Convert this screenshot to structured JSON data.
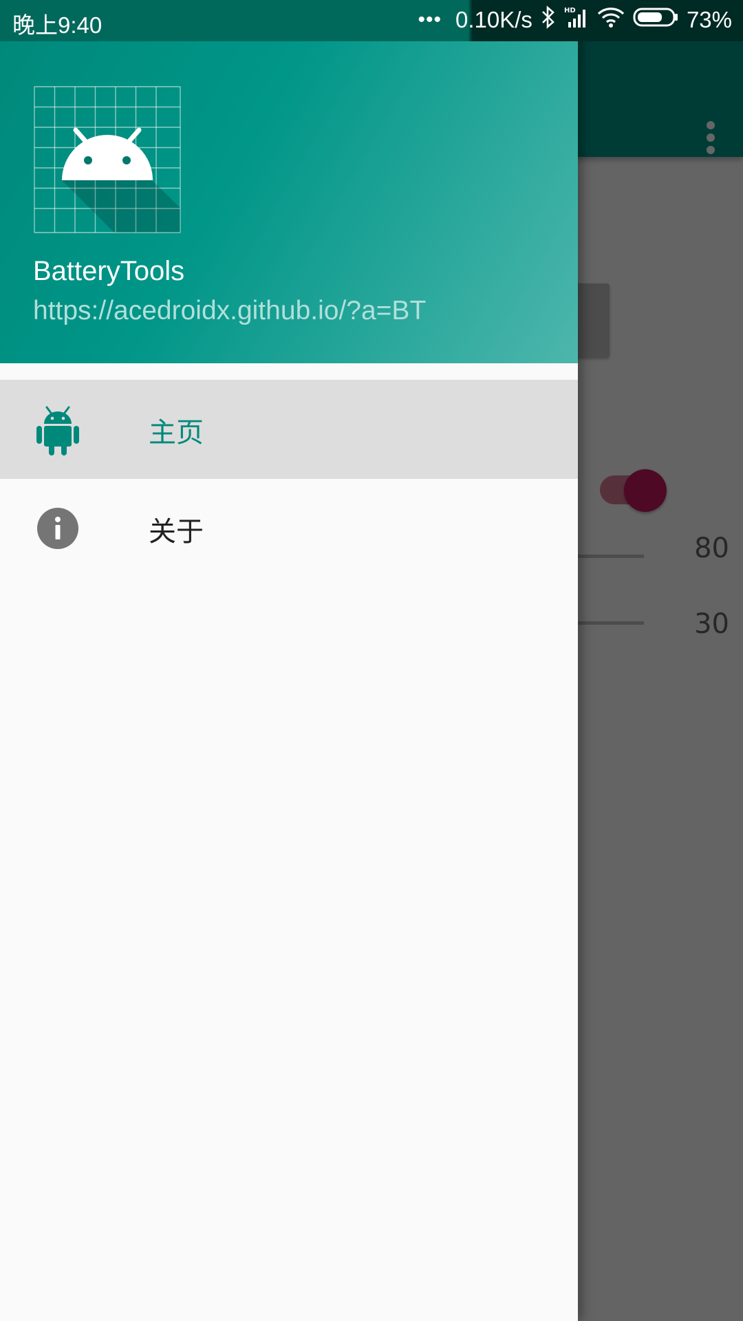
{
  "status_bar": {
    "time": "晚上9:40",
    "dots": "•••",
    "network_speed": "0.10K/s",
    "bluetooth_icon": "bluetooth-icon",
    "signal_icon": "hd-signal-icon",
    "wifi_icon": "wifi-icon",
    "battery_icon": "battery-icon",
    "battery_percent": "73%",
    "battery_level": 0.73
  },
  "drawer": {
    "header": {
      "logo_icon": "android-grid-logo-icon",
      "title": "BatteryTools",
      "subtitle": "https://acedroidx.github.io/?a=BT"
    },
    "items": [
      {
        "label": "主页",
        "icon": "android-icon",
        "selected": true
      },
      {
        "label": "关于",
        "icon": "info-icon",
        "selected": false
      }
    ]
  },
  "background_app": {
    "overflow_icon": "more-vert-icon",
    "switch_on": true,
    "sliders": [
      {
        "value": "80"
      },
      {
        "value": "30"
      }
    ]
  },
  "colors": {
    "primary": "#009688",
    "primary_dark": "#00695c",
    "accent": "#c2185b",
    "selected_item_bg": "#dddddd",
    "drawer_bg": "#fafafa"
  }
}
